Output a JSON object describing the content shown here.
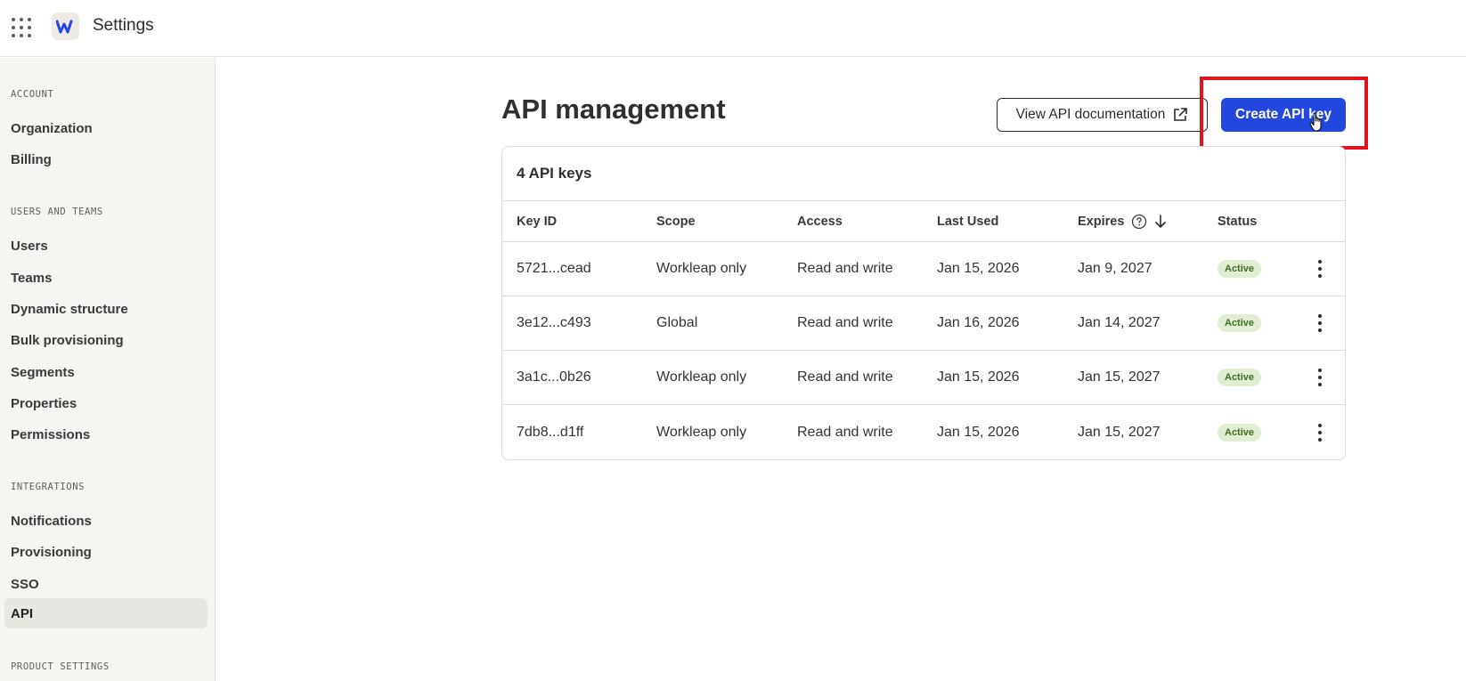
{
  "header": {
    "title": "Settings",
    "logo_letter": "W"
  },
  "sidebar": {
    "sections": [
      {
        "label": "ACCOUNT",
        "items": [
          "Organization",
          "Billing"
        ]
      },
      {
        "label": "USERS AND TEAMS",
        "items": [
          "Users",
          "Teams",
          "Dynamic structure",
          "Bulk provisioning",
          "Segments",
          "Properties",
          "Permissions"
        ]
      },
      {
        "label": "INTEGRATIONS",
        "items": [
          "Notifications",
          "Provisioning",
          "SSO",
          "API"
        ]
      },
      {
        "label": "PRODUCT SETTINGS",
        "items": []
      }
    ],
    "active_item": "API"
  },
  "main": {
    "title": "API management",
    "doc_button": "View API documentation",
    "create_button": "Create API key",
    "card_title": "4 API keys",
    "columns": [
      "Key ID",
      "Scope",
      "Access",
      "Last Used",
      "Expires",
      "Status"
    ],
    "rows": [
      {
        "key_id": "5721...cead",
        "scope": "Workleap only",
        "access": "Read and write",
        "last_used": "Jan 15, 2026",
        "expires": "Jan 9, 2027",
        "status": "Active"
      },
      {
        "key_id": "3e12...c493",
        "scope": "Global",
        "access": "Read and write",
        "last_used": "Jan 16, 2026",
        "expires": "Jan 14, 2027",
        "status": "Active"
      },
      {
        "key_id": "3a1c...0b26",
        "scope": "Workleap only",
        "access": "Read and write",
        "last_used": "Jan 15, 2026",
        "expires": "Jan 15, 2027",
        "status": "Active"
      },
      {
        "key_id": "7db8...d1ff",
        "scope": "Workleap only",
        "access": "Read and write",
        "last_used": "Jan 15, 2026",
        "expires": "Jan 15, 2027",
        "status": "Active"
      }
    ]
  },
  "colors": {
    "primary": "#2348e0",
    "highlight": "#e3141d",
    "badge_bg": "#e2eed3",
    "badge_text": "#3f6e23",
    "sidebar_bg": "#f6f5f2"
  }
}
